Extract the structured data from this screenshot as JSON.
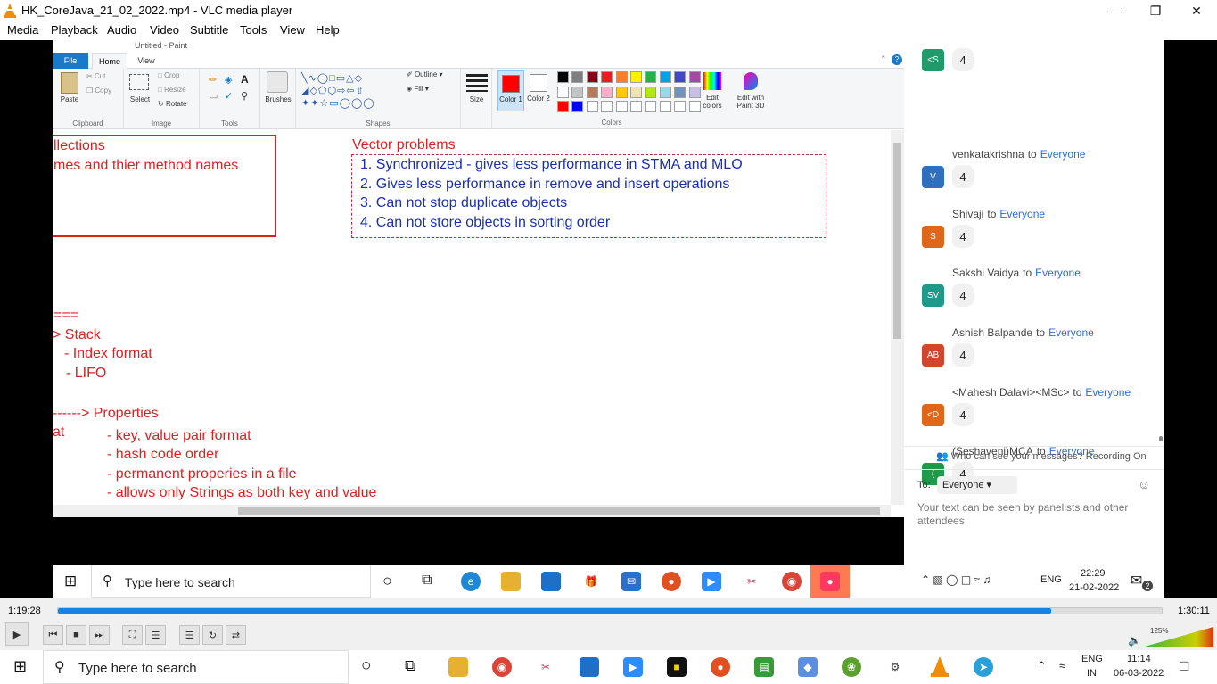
{
  "window": {
    "title": "HK_CoreJava_21_02_2022.mp4 - VLC media player"
  },
  "menu": [
    "Media",
    "Playback",
    "Audio",
    "Video",
    "Subtitle",
    "Tools",
    "View",
    "Help"
  ],
  "paint": {
    "doc_title": "Untitled - Paint",
    "tabs": {
      "file": "File",
      "home": "Home",
      "view": "View"
    },
    "ribbon": {
      "clipboard": {
        "paste": "Paste",
        "cut": "Cut",
        "copy": "Copy",
        "label": "Clipboard"
      },
      "image": {
        "select": "Select",
        "crop": "Crop",
        "resize": "Resize",
        "rotate": "Rotate",
        "label": "Image"
      },
      "tools": {
        "label": "Tools"
      },
      "brushes": "Brushes",
      "shapes": {
        "outline": "Outline",
        "fill": "Fill",
        "label": "Shapes"
      },
      "size": "Size",
      "color1": "Color 1",
      "color2": "Color 2",
      "colors_label": "Colors",
      "edit_colors": "Edit colors",
      "edit_paint3d": "Edit with Paint 3D"
    },
    "palette": [
      "#000000",
      "#7f7f7f",
      "#880015",
      "#ed1c24",
      "#ff7f27",
      "#fff200",
      "#22b14c",
      "#00a2e8",
      "#3f48cc",
      "#a349a4",
      "#ffffff",
      "#c3c3c3",
      "#b97a57",
      "#ffaec9",
      "#ffc90e",
      "#efe4b0",
      "#b5e61d",
      "#99d9ea",
      "#7092be",
      "#c8bfe7",
      "#ff0000",
      "#0000ff",
      "#ffffff",
      "#ffffff",
      "#ffffff",
      "#ffffff",
      "#ffffff",
      "#ffffff",
      "#ffffff",
      "#ffffff"
    ],
    "canvas": {
      "box_left_line1": "llections",
      "box_left_line2": "mes and thier method names",
      "vector_title": "Vector problems",
      "vector_items": [
        "1. Synchronized - gives less performance in STMA and MLO",
        "2. Gives less performance in remove and insert operations",
        "3. Can not stop duplicate objects",
        "4. Can not store objects in sorting order"
      ],
      "eq_marks": "===",
      "stack": "> Stack",
      "stack_items": [
        "- Index format",
        "- LIFO"
      ],
      "properties": "------> Properties",
      "at": "at",
      "prop_items": [
        "- key, value pair format",
        "- hash code order",
        "- permanent properies in a file",
        "- allows only Strings as both key and value"
      ]
    }
  },
  "chat": {
    "entries": [
      {
        "name": "",
        "to": "",
        "initials": "<S",
        "color": "#1f9a6a",
        "message": "4"
      },
      {
        "name": "venkatakrishna",
        "to": "Everyone",
        "initials": "V",
        "color": "#2f6fc0",
        "message": "4"
      },
      {
        "name": "Shivaji",
        "to": "Everyone",
        "initials": "S",
        "color": "#e0661a",
        "message": "4"
      },
      {
        "name": "Sakshi Vaidya",
        "to": "Everyone",
        "initials": "SV",
        "color": "#1f9a8a",
        "message": "4"
      },
      {
        "name": "Ashish Balpande",
        "to": "Everyone",
        "initials": "AB",
        "color": "#d2452e",
        "message": "4"
      },
      {
        "name": "<Mahesh Dalavi><MSc>",
        "to": "Everyone",
        "initials": "<D",
        "color": "#e0661a",
        "message": "4"
      },
      {
        "name": "(Seshaveni)MCA",
        "to": "Everyone",
        "initials": "(",
        "color": "#1f9a4a",
        "message": "4"
      }
    ],
    "to_word": "to",
    "notice": "Who can see your messages? Recording On",
    "to_label": "To:",
    "recipient": "Everyone",
    "hint": "Your text can be seen by panelists and other attendees"
  },
  "inner_taskbar": {
    "search_placeholder": "Type here to search",
    "lang": "ENG",
    "time": "22:29",
    "date": "21-02-2022",
    "notif_count": "2"
  },
  "player": {
    "elapsed": "1:19:28",
    "total": "1:30:11",
    "progress": 0.9,
    "volume_label": "125%",
    "volume": 1.0
  },
  "outer_taskbar": {
    "search_placeholder": "Type here to search",
    "lang": "ENG",
    "region": "IN",
    "time": "11:14",
    "date": "06-03-2022"
  }
}
